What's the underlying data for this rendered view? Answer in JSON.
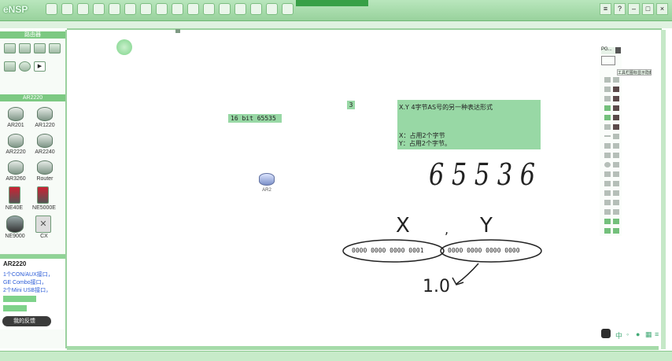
{
  "app": {
    "title": "eNSP"
  },
  "left_panel": {
    "header": "路由器",
    "section_band": "AR2220",
    "routers": [
      "AR201",
      "AR1220",
      "AR2220",
      "AR2240",
      "AR3260",
      "Router",
      "NE40E",
      "NE5000E",
      "NE9000",
      "CX"
    ],
    "desc_title": "AR2220",
    "desc_lines": [
      "1个CON/AUX接口，",
      "GE Combo接口，",
      "2个Mini USB接口，"
    ],
    "feedback_button": "我的反馈"
  },
  "canvas": {
    "device_label": "AR2",
    "note_16bit": "16 bit  65535",
    "note_3": "3",
    "note_xy": {
      "line1": "X.Y    4字节AS号的另一种表达形式",
      "line2": "X：占用2个字节",
      "line3": "Y：占用2个字节。"
    },
    "binary_x": "0000 0000  0000 0001",
    "binary_y": "0000 0000  0000 0000",
    "handwriting": {
      "number": "65536",
      "x": "X",
      "comma": ",",
      "y": "Y",
      "result": "1.0"
    }
  },
  "palette": {
    "tab_label": "PG...",
    "tooltip": "工具栏图标显示隐藏"
  },
  "colors": {
    "titlebar": "#a6dbaa",
    "note_bg": "#98d8a5",
    "accent_green": "#38a047",
    "handwriting": "#222222"
  }
}
